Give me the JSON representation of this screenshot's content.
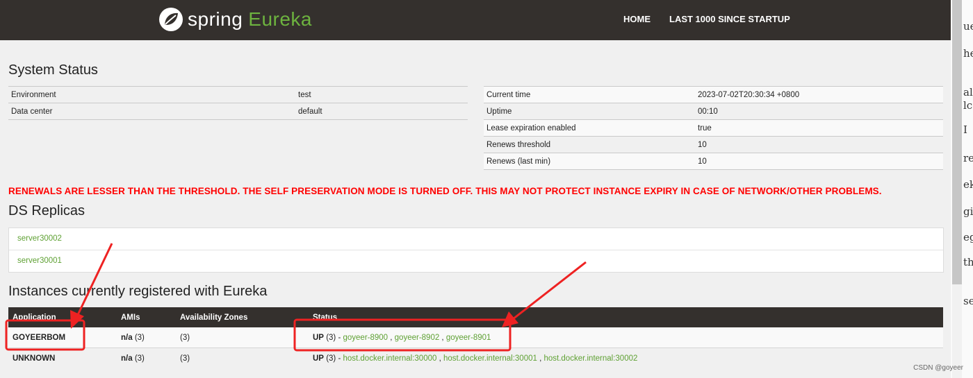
{
  "header": {
    "logo_spring": "spring",
    "logo_eureka": "Eureka",
    "nav": [
      "HOME",
      "LAST 1000 SINCE STARTUP"
    ]
  },
  "system_status": {
    "title": "System Status",
    "left_rows": [
      {
        "label": "Environment",
        "value": "test"
      },
      {
        "label": "Data center",
        "value": "default"
      }
    ],
    "right_rows": [
      {
        "label": "Current time",
        "value": "2023-07-02T20:30:34 +0800"
      },
      {
        "label": "Uptime",
        "value": "00:10"
      },
      {
        "label": "Lease expiration enabled",
        "value": "true"
      },
      {
        "label": "Renews threshold",
        "value": "10"
      },
      {
        "label": "Renews (last min)",
        "value": "10"
      }
    ]
  },
  "warning": "RENEWALS ARE LESSER THAN THE THRESHOLD. THE SELF PRESERVATION MODE IS TURNED OFF. THIS MAY NOT PROTECT INSTANCE EXPIRY IN CASE OF NETWORK/OTHER PROBLEMS.",
  "ds_replicas": {
    "title": "DS Replicas",
    "items": [
      "server30002",
      "server30001"
    ]
  },
  "instances": {
    "title": "Instances currently registered with Eureka",
    "columns": [
      "Application",
      "AMIs",
      "Availability Zones",
      "Status"
    ],
    "rows": [
      {
        "application": "GOYEERBOM",
        "amis_na": "n/a",
        "amis_count": "(3)",
        "zones": "(3)",
        "status_prefix": "UP",
        "status_count": "(3) -",
        "links": [
          "goyeer-8900",
          "goyeer-8902",
          "goyeer-8901"
        ]
      },
      {
        "application": "UNKNOWN",
        "amis_na": "n/a",
        "amis_count": "(3)",
        "zones": "(3)",
        "status_prefix": "UP",
        "status_count": "(3) -",
        "links": [
          "host.docker.internal:30000",
          "host.docker.internal:30001",
          "host.docker.internal:30002"
        ]
      }
    ]
  },
  "side_text": [
    "ue",
    "he",
    "al",
    "lc",
    "I",
    "re",
    "ek",
    "gi",
    "eg",
    "th",
    "se"
  ],
  "watermark": "CSDN @goyeer",
  "colors": {
    "header_bg": "#34302d",
    "brand_green": "#6db33f",
    "link_green": "#5fa134",
    "warning_red": "#ff0000",
    "annotation_red": "#ee2222"
  }
}
